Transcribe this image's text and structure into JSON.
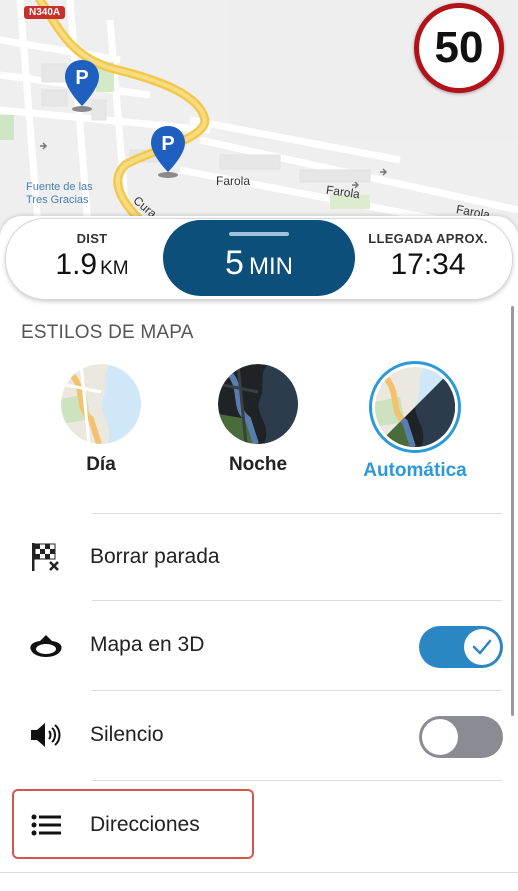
{
  "map": {
    "road_badge": "N340A",
    "speed_limit": "50",
    "labels": {
      "poi": "Fuente de las\nTres Gracias",
      "street1": "Farola",
      "street2": "Farola",
      "street3": "Farola",
      "street4": "Cura"
    },
    "parking_icon": "parking-pin-icon",
    "colors": {
      "route": "#f2c94c",
      "parking": "#1f5fbf",
      "speed_ring": "#b3121b"
    }
  },
  "trip": {
    "dist_label": "DIST",
    "dist_value": "1.9",
    "dist_unit": "KM",
    "time_value": "5",
    "time_unit": "MIN",
    "eta_label": "LLEGADA APROX.",
    "eta_value": "17:34"
  },
  "map_styles": {
    "title": "ESTILOS DE MAPA",
    "options": [
      {
        "label": "Día",
        "selected": false
      },
      {
        "label": "Noche",
        "selected": false
      },
      {
        "label": "Automática",
        "selected": true
      }
    ],
    "accent": "#2c9ad9"
  },
  "menu": {
    "items": [
      {
        "label": "Borrar parada",
        "icon": "checkered-flag-x-icon"
      },
      {
        "label": "Mapa en 3D",
        "icon": "3d-map-ring-icon",
        "toggle": true
      },
      {
        "label": "Silencio",
        "icon": "speaker-icon",
        "toggle": false
      },
      {
        "label": "Direcciones",
        "icon": "list-icon"
      }
    ]
  }
}
